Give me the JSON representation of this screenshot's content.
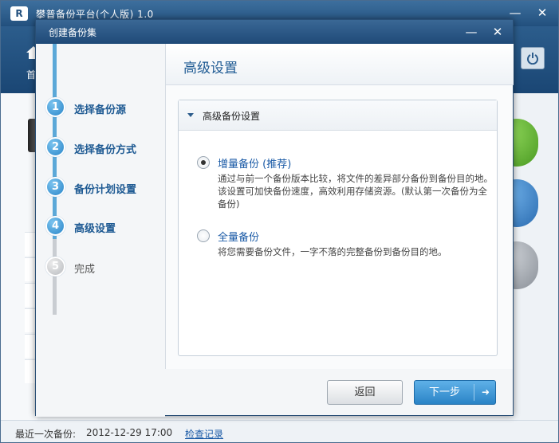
{
  "main_window": {
    "title": "攀普备份平台(个人版) 1.0",
    "logo_text": "R",
    "minimize": "—",
    "close": "✕",
    "home_label": "首",
    "status": {
      "prefix": "最近一次备份:",
      "time": "2012-12-29 17:00",
      "link": "检查记录"
    }
  },
  "dialog": {
    "title": "创建备份集",
    "minimize": "—",
    "close": "✕",
    "steps": [
      {
        "number": "1",
        "label": "选择备份源",
        "state": "done"
      },
      {
        "number": "2",
        "label": "选择备份方式",
        "state": "done"
      },
      {
        "number": "3",
        "label": "备份计划设置",
        "state": "done"
      },
      {
        "number": "4",
        "label": "高级设置",
        "state": "current"
      },
      {
        "number": "5",
        "label": "完成",
        "state": "pending"
      }
    ],
    "content_title": "高级设置",
    "section_title": "高级备份设置",
    "options": [
      {
        "title": "增量备份 (推荐)",
        "description": "通过与前一个备份版本比较，将文件的差异部分备份到备份目的地。该设置可加快备份速度，高效利用存储资源。(默认第一次备份为全备份)",
        "checked": true
      },
      {
        "title": "全量备份",
        "description": "将您需要备份文件，一字不落的完整备份到备份目的地。",
        "checked": false
      }
    ],
    "back_button": "返回",
    "next_button": "下一步",
    "next_arrow": "➜"
  },
  "colors": {
    "titlebar": "#22507e",
    "accent": "#2a83c6",
    "step_active": "#1e5a93"
  }
}
